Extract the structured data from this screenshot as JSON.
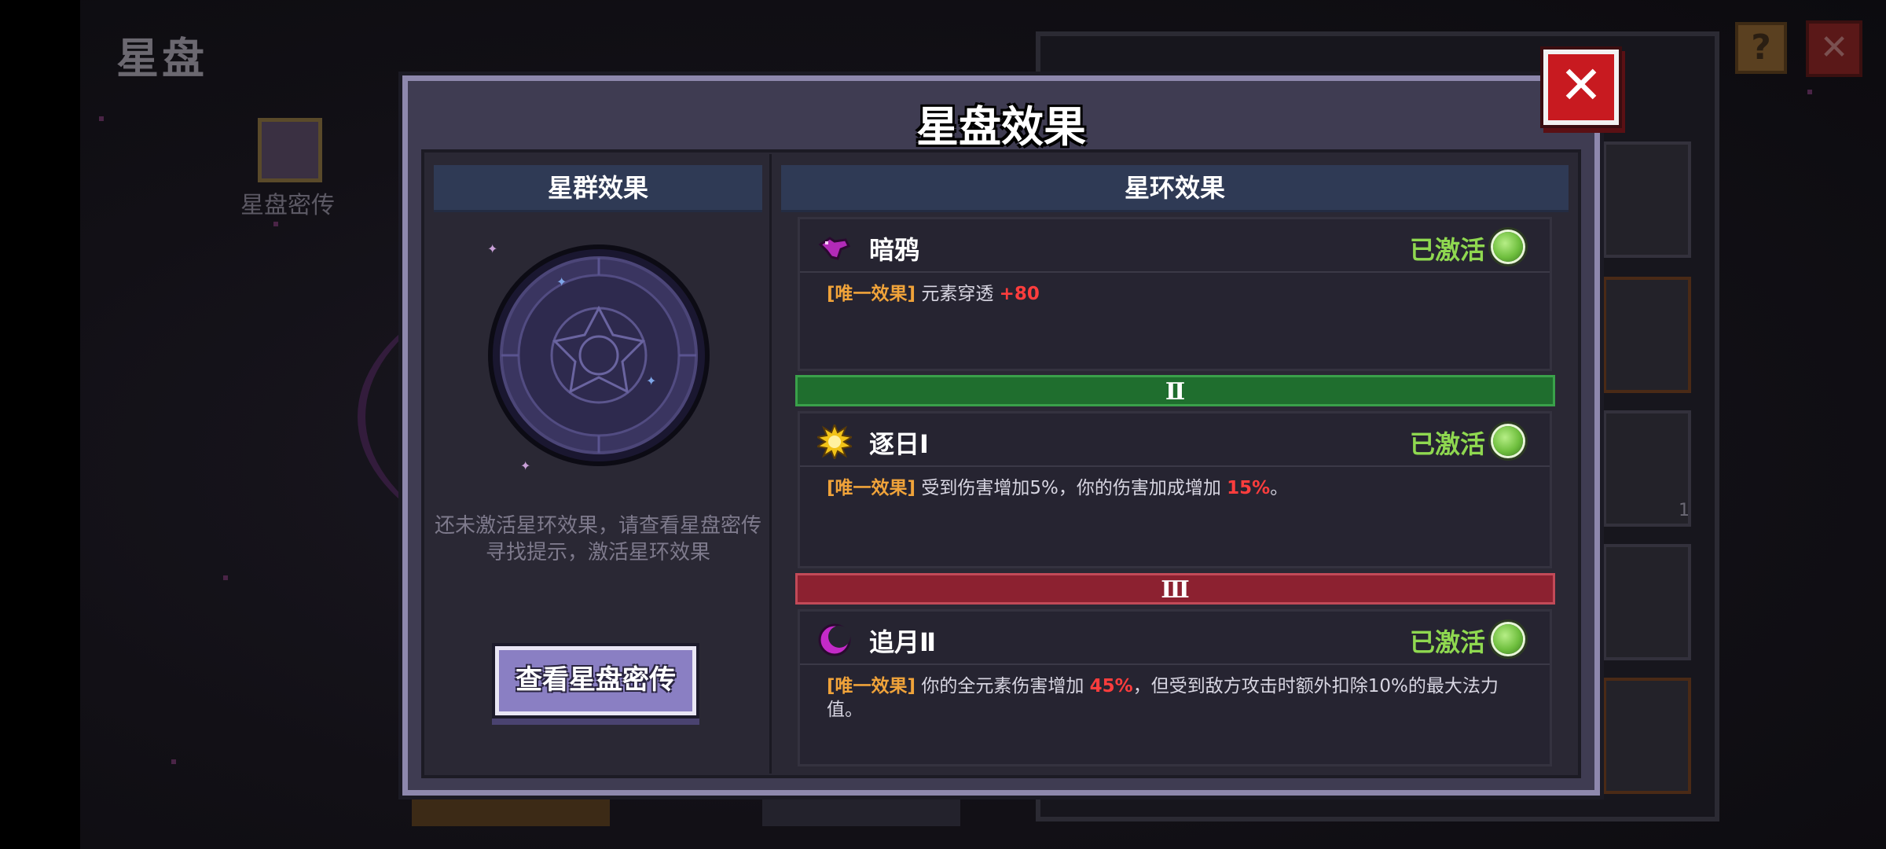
{
  "background": {
    "page_title": "星盘",
    "book_label": "星盘密传",
    "help_icon": "?",
    "close_icon": "✕",
    "slot_count": "1"
  },
  "dialog": {
    "title": "星盘效果",
    "close_icon": "✕",
    "left_panel": {
      "header": "星群效果",
      "hint": "还未激活星环效果，请查看星盘密传寻找提示，激活星环效果",
      "button_label": "查看星盘密传"
    },
    "right_panel": {
      "header": "星环效果",
      "effects": [
        {
          "name": "暗鸦",
          "icon": "raven-icon",
          "status": "已激活",
          "tag": "[唯一效果]",
          "desc_before": "元素穿透 ",
          "highlight": "+80",
          "desc_after": ""
        },
        {
          "name": "逐日Ⅰ",
          "icon": "sun-icon",
          "status": "已激活",
          "tag": "[唯一效果]",
          "desc_before": "受到伤害增加5%，你的伤害加成增加 ",
          "highlight": "15%",
          "desc_after": "。"
        },
        {
          "name": "追月Ⅱ",
          "icon": "moon-icon",
          "status": "已激活",
          "tag": "[唯一效果]",
          "desc_before": "你的全元素伤害增加 ",
          "highlight": "45%",
          "desc_after": "，但受到敌方攻击时额外扣除10%的最大法力值。"
        }
      ],
      "tiers": [
        {
          "label": "Ⅱ",
          "color": "#1f6e2e"
        },
        {
          "label": "Ⅲ",
          "color": "#8c2130"
        }
      ]
    }
  },
  "colors": {
    "active_green": "#8fd850",
    "tag_orange": "#f0a33a",
    "highlight_red": "#ff3d3d",
    "panel_header": "#2f3a55",
    "close_red": "#c81a20"
  }
}
